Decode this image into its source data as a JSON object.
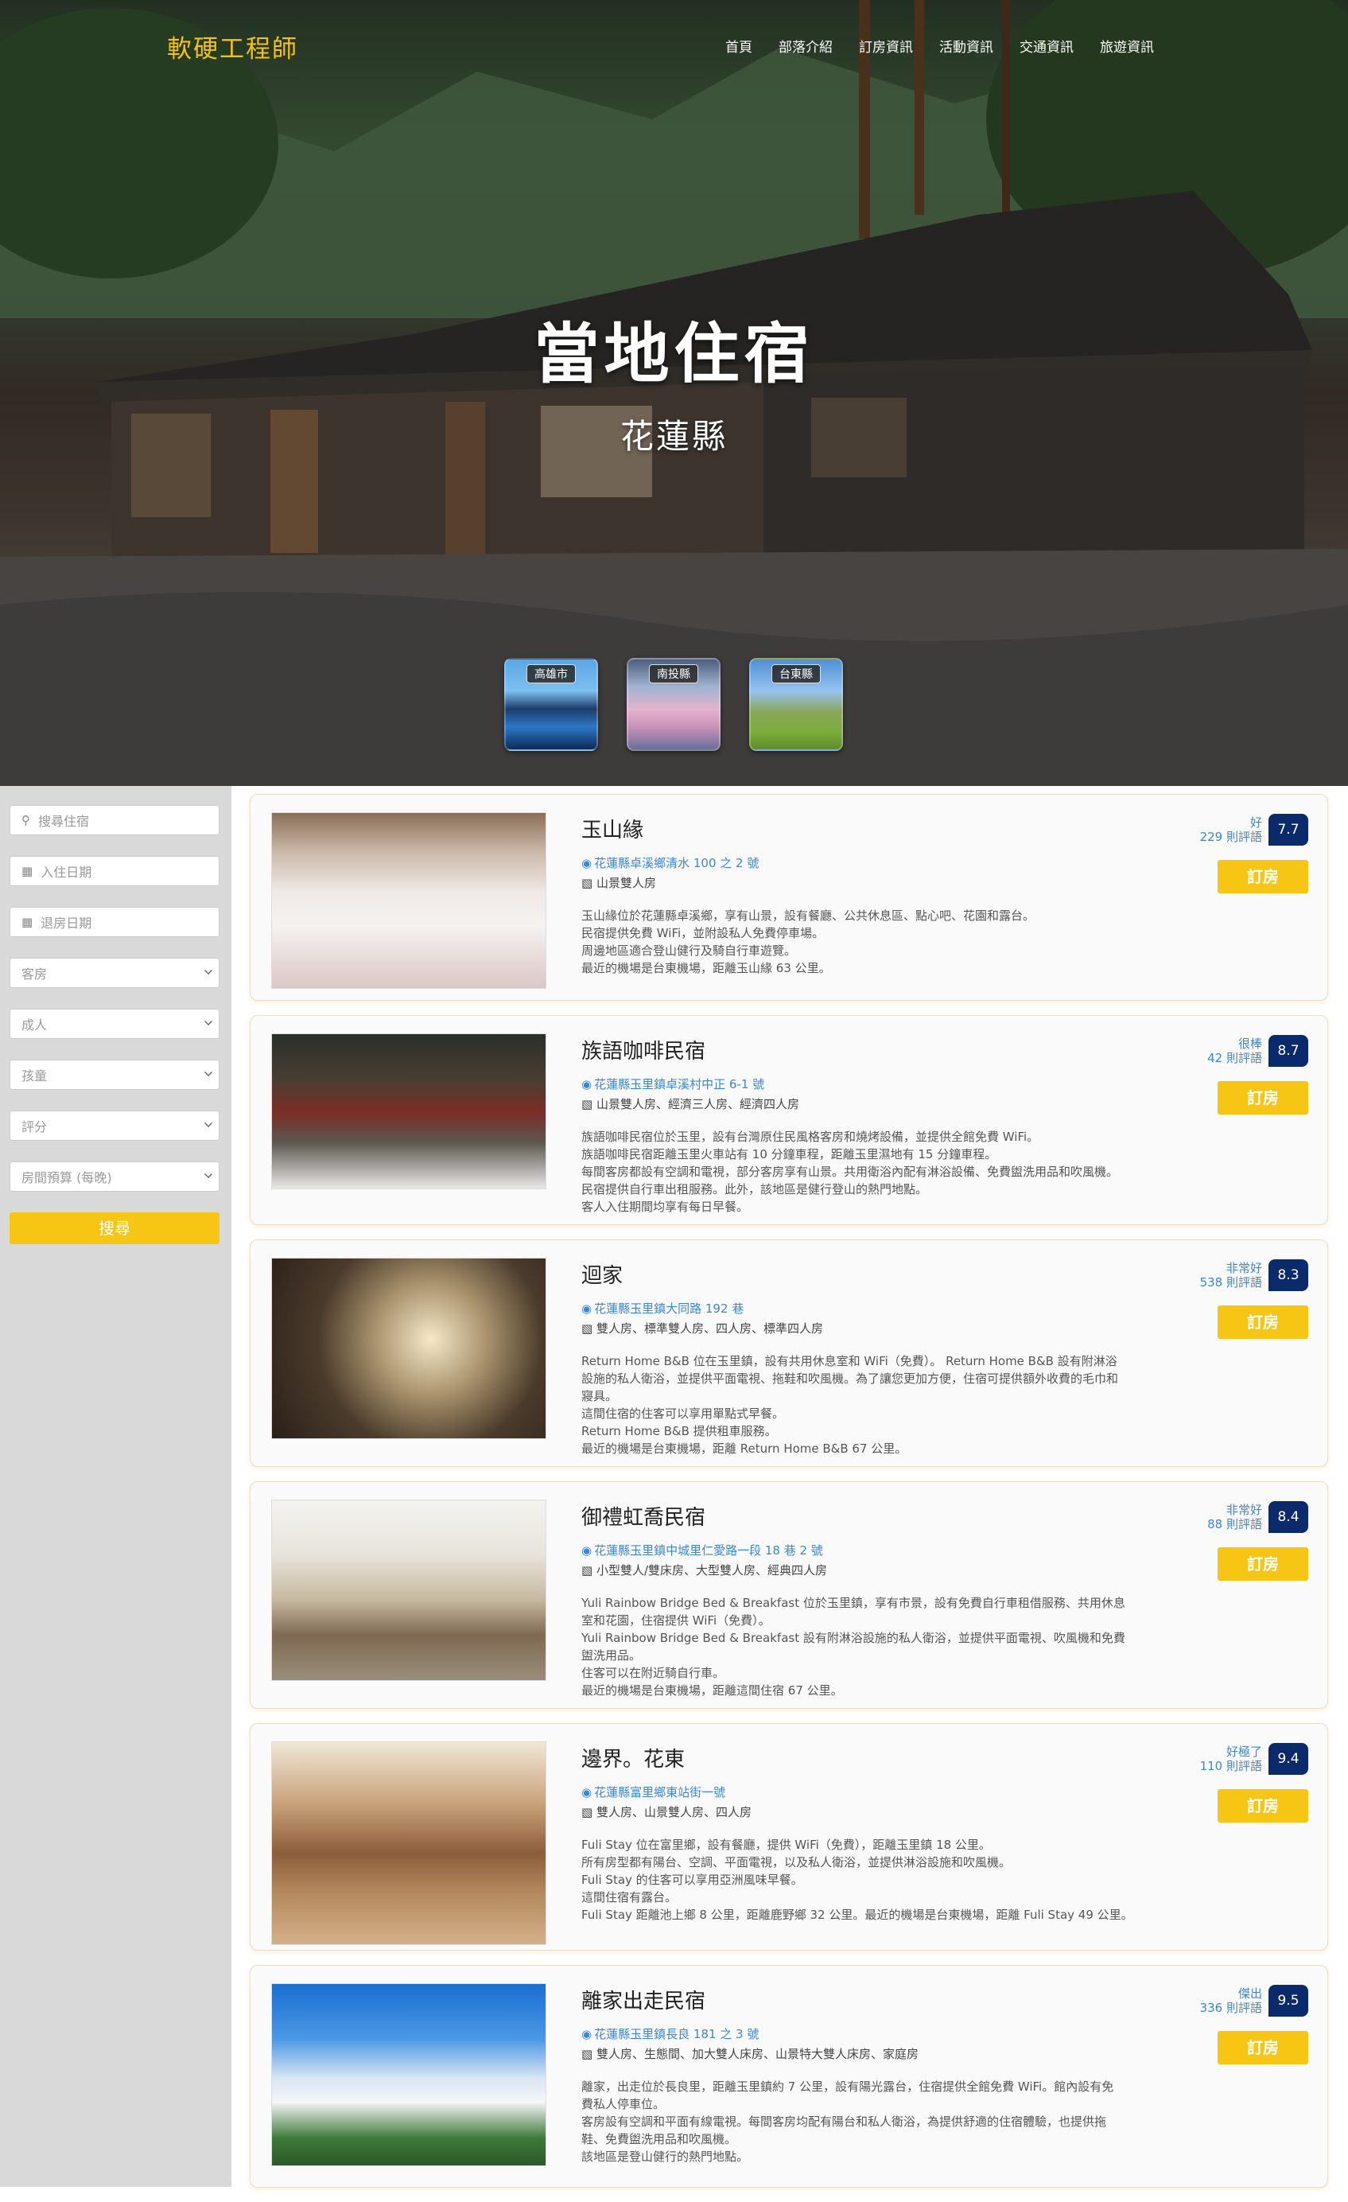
{
  "header": {
    "brand": "軟硬工程師",
    "nav": [
      "首頁",
      "部落介紹",
      "訂房資訊",
      "活動資訊",
      "交通資訊",
      "旅遊資訊"
    ]
  },
  "hero": {
    "title": "當地住宿",
    "subtitle": "花蓮縣",
    "counties": [
      "高雄市",
      "南投縣",
      "台東縣"
    ]
  },
  "sidebar": {
    "search_placeholder": "搜尋住宿",
    "checkin_placeholder": "入住日期",
    "checkout_placeholder": "退房日期",
    "selects": [
      "客房",
      "成人",
      "孩童",
      "評分",
      "房間預算 (每晚)"
    ],
    "search_button": "搜尋"
  },
  "book_label": "訂房",
  "listings": [
    {
      "name": "玉山緣",
      "address": "花蓮縣卓溪鄉清水 100 之 2 號",
      "rooms": "山景雙人房",
      "desc": [
        "玉山緣位於花蓮縣卓溪鄉，享有山景，設有餐廳、公共休息區、點心吧、花園和露台。",
        "民宿提供免費 WiFi，並附設私人免費停車場。",
        "周邊地區適合登山健行及騎自行車遊覽。",
        "最近的機場是台東機場，距離玉山緣 63 公里。"
      ],
      "rating_word": "好",
      "reviews": "229 則評語",
      "score": "7.7"
    },
    {
      "name": "族語咖啡民宿",
      "address": "花蓮縣玉里鎮卓溪村中正 6-1 號",
      "rooms": "山景雙人房、經濟三人房、經濟四人房",
      "desc": [
        "族語咖啡民宿位於玉里，設有台灣原住民風格客房和燒烤設備，並提供全館免費 WiFi。",
        "族語咖啡民宿距離玉里火車站有 10 分鐘車程，距離玉里濕地有 15 分鐘車程。",
        "每間客房都設有空調和電視，部分客房享有山景。共用衛浴內配有淋浴設備、免費盥洗用品和吹風機。",
        "民宿提供自行車出租服務。此外，該地區是健行登山的熱門地點。",
        "客人入住期間均享有每日早餐。"
      ],
      "rating_word": "很棒",
      "reviews": "42 則評語",
      "score": "8.7"
    },
    {
      "name": "迴家",
      "address": "花蓮縣玉里鎮大同路 192 巷",
      "rooms": "雙人房、標準雙人房、四人房、標準四人房",
      "desc": [
        "Return Home B&B 位在玉里鎮，設有共用休息室和 WiFi（免費）。 Return Home B&B 設有附淋浴",
        "設施的私人衛浴，並提供平面電視、拖鞋和吹風機。為了讓您更加方便，住宿可提供額外收費的毛巾和",
        "寢具。",
        "這間住宿的住客可以享用單點式早餐。",
        "Return Home B&B 提供租車服務。",
        "最近的機場是台東機場，距離 Return Home B&B 67 公里。"
      ],
      "rating_word": "非常好",
      "reviews": "538 則評語",
      "score": "8.3"
    },
    {
      "name": "御禮虹喬民宿",
      "address": "花蓮縣玉里鎮中城里仁愛路一段 18 巷 2 號",
      "rooms": "小型雙人/雙床房、大型雙人房、經典四人房",
      "desc": [
        "Yuli Rainbow Bridge Bed & Breakfast 位於玉里鎮，享有市景，設有免費自行車租借服務、共用休息",
        "室和花園，住宿提供 WiFi（免費）。",
        "Yuli Rainbow Bridge Bed & Breakfast 設有附淋浴設施的私人衛浴，並提供平面電視、吹風機和免費",
        "盥洗用品。",
        "住客可以在附近騎自行車。",
        "最近的機場是台東機場，距離這間住宿 67 公里。"
      ],
      "rating_word": "非常好",
      "reviews": "88 則評語",
      "score": "8.4"
    },
    {
      "name": "邊界。花東",
      "address": "花蓮縣富里鄉東站街一號",
      "rooms": "雙人房、山景雙人房、四人房",
      "desc": [
        "Fuli Stay 位在富里鄉，設有餐廳，提供 WiFi（免費），距離玉里鎮 18 公里。",
        "所有房型都有陽台、空調、平面電視，以及私人衛浴，並提供淋浴設施和吹風機。",
        "Fuli Stay 的住客可以享用亞洲風味早餐。",
        "這間住宿有露台。",
        "Fuli Stay 距離池上鄉 8 公里，距離鹿野鄉 32 公里。最近的機場是台東機場，距離 Fuli Stay 49 公里。"
      ],
      "rating_word": "好極了",
      "reviews": "110 則評語",
      "score": "9.4"
    },
    {
      "name": "離家出走民宿",
      "address": "花蓮縣玉里鎮長良 181 之 3 號",
      "rooms": "雙人房、生態間、加大雙人床房、山景特大雙人床房、家庭房",
      "desc": [
        "離家，出走位於長良里，距離玉里鎮約 7 公里，設有陽光露台，住宿提供全館免費 WiFi。館內設有免",
        "費私人停車位。",
        "客房設有空調和平面有線電視。每間客房均配有陽台和私人衛浴，為提供舒適的住宿體驗，也提供拖",
        "鞋、免費盥洗用品和吹風機。",
        "該地區是登山健行的熱門地點。"
      ],
      "rating_word": "傑出",
      "reviews": "336 則評語",
      "score": "9.5"
    }
  ]
}
